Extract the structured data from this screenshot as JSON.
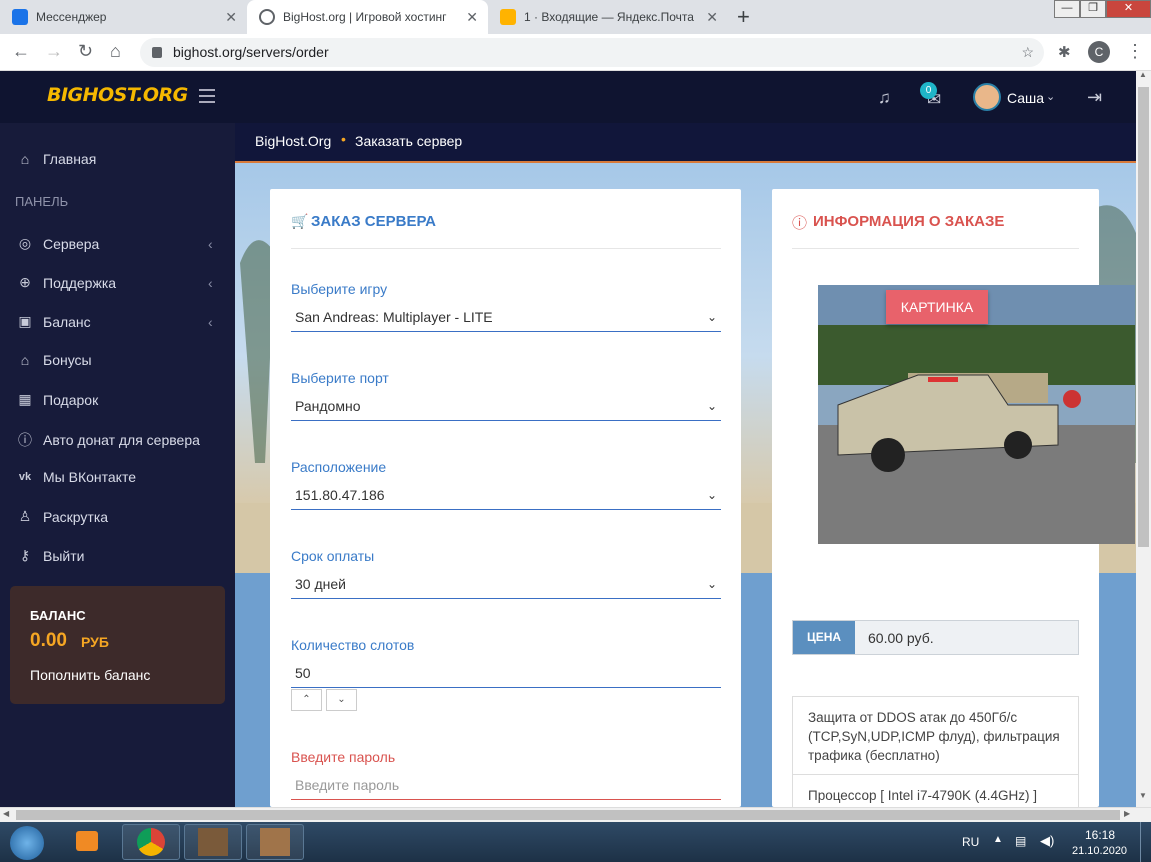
{
  "browser": {
    "tabs": [
      {
        "title": "Мессенджер",
        "active": false,
        "icon_color": "#1a73e8"
      },
      {
        "title": "BigHost.org | Игровой хостинг",
        "active": true,
        "icon_color": "#5f6368"
      },
      {
        "title": "1 · Входящие — Яндекс.Почта",
        "active": false,
        "icon_color": "#ffb300"
      }
    ],
    "url": "bighost.org/servers/order",
    "profile_initial": "C"
  },
  "site": {
    "logo": "BIGHOST.ORG",
    "notifications_count": "0",
    "user_name": "Саша",
    "breadcrumb": {
      "home": "BigHost.Org",
      "current": "Заказать сервер"
    }
  },
  "sidebar": {
    "home": "Главная",
    "panel_label": "ПАНЕЛЬ",
    "items": [
      {
        "label": "Сервера",
        "icon": "server-icon",
        "glyph": "◎",
        "arrow": true
      },
      {
        "label": "Поддержка",
        "icon": "support-icon",
        "glyph": "⊕",
        "arrow": true
      },
      {
        "label": "Баланс",
        "icon": "wallet-icon",
        "glyph": "▣",
        "arrow": true
      },
      {
        "label": "Бонусы",
        "icon": "gift-icon",
        "glyph": "⌂",
        "arrow": false
      },
      {
        "label": "Подарок",
        "icon": "present-icon",
        "glyph": "▦",
        "arrow": false
      },
      {
        "label": "Авто донат для сервера",
        "icon": "info-icon",
        "glyph": "ⓘ",
        "arrow": false
      },
      {
        "label": "Мы ВКонтакте",
        "icon": "vk-icon",
        "glyph": "vk",
        "arrow": false
      },
      {
        "label": "Раскрутка",
        "icon": "user-icon",
        "glyph": "♙",
        "arrow": false
      },
      {
        "label": "Выйти",
        "icon": "key-icon",
        "glyph": "⚷",
        "arrow": false
      }
    ],
    "balance": {
      "title": "БАЛАНС",
      "amount": "0.00",
      "currency": "РУБ",
      "topup": "Пополнить баланс"
    }
  },
  "order_form": {
    "title": "ЗАКАЗ СЕРВЕРА",
    "game_label": "Выберите игру",
    "game_value": "San Andreas: Multiplayer - LITE",
    "port_label": "Выберите порт",
    "port_value": "Рандомно",
    "location_label": "Расположение",
    "location_value": "151.80.47.186",
    "term_label": "Срок оплаты",
    "term_value": "30 дней",
    "slots_label": "Количество слотов",
    "slots_value": "50",
    "password_label": "Введите пароль",
    "password_placeholder": "Введите пароль"
  },
  "order_info": {
    "title": "ИНФОРМАЦИЯ О ЗАКАЗЕ",
    "image_badge": "КАРТИНКА",
    "price_label": "ЦЕНА",
    "price_value": "60.00 руб.",
    "features": [
      "Защита от DDOS атак до 450Гб/с (TCP,SyN,UDP,ICMP флуд), фильтрация трафика (бесплатно)",
      "Процессор [ Intel i7-4790K (4.4GHz) ]"
    ]
  },
  "taskbar": {
    "lang": "RU",
    "time": "16:18",
    "date": "21.10.2020"
  }
}
